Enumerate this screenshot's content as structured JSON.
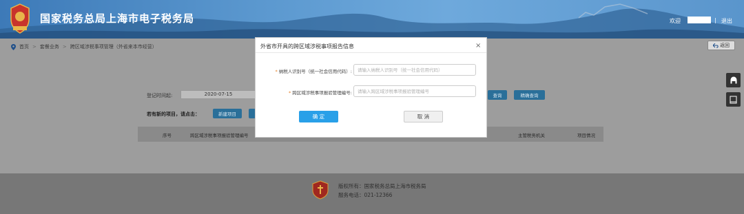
{
  "header": {
    "title": "国家税务总局上海市电子税务局",
    "welcome": "欢迎",
    "separator": "|",
    "logout": "退出"
  },
  "breadcrumb": {
    "items": [
      "首页",
      "套餐业务",
      "跨区域涉税事项管理（外省来本市经营）"
    ],
    "arrow": ">"
  },
  "back_button": "返回",
  "form": {
    "date_label": "登记时间起:",
    "date_value": "2020-07-15",
    "query_button": "查询",
    "detail_query_button": "精确查询",
    "new_project_prompt": "若有新的项目，请点击：",
    "new_project_button": "新建项目"
  },
  "table": {
    "headers": [
      "序号",
      "跨区域涉税事项报验管理编号",
      "主管税务机关",
      "项目情况"
    ]
  },
  "footer": {
    "copyright": "版权所有：国家税务总局上海市税务局",
    "phone": "服务电话：021-12366"
  },
  "modal": {
    "title": "外省市开具的跨区域涉税事项报告信息",
    "close": "×",
    "field1": {
      "label": "纳税人识别号（统一社会信用代码）:",
      "placeholder": "请输入纳税人识别号（统一社会信用代码）"
    },
    "field2": {
      "label": "跨区域涉税事项报验管理编号:",
      "placeholder": "请输入跨区域涉税事项报验管理编号"
    },
    "required_mark": "*",
    "ok": "确 定",
    "cancel": "取 消"
  },
  "colors": {
    "primary": "#29a0e8",
    "header_blue": "#4a88c4",
    "required": "#e67e22"
  },
  "icons": [
    "emblem-icon",
    "location-pin-icon",
    "back-arrow-icon",
    "headset-icon",
    "book-icon",
    "close-icon"
  ]
}
